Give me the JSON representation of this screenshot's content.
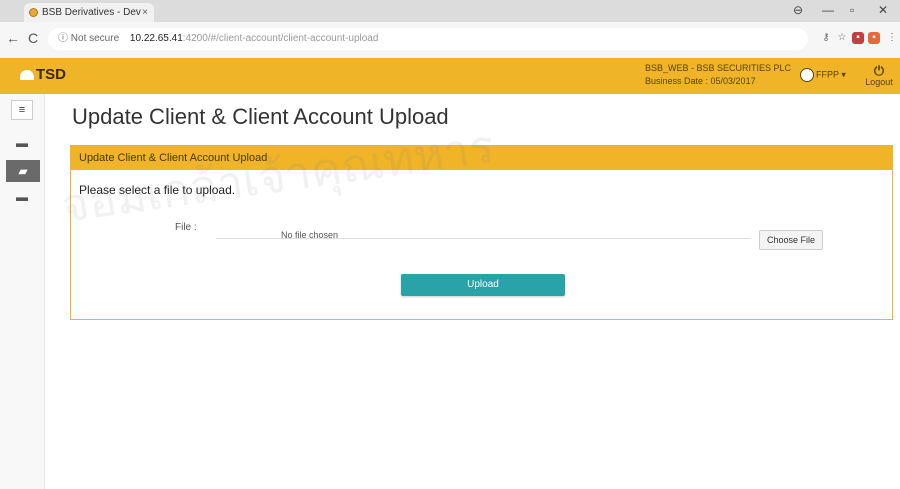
{
  "browser": {
    "tab_title": "BSB Derivatives - Dev",
    "security_label": "Not secure",
    "url_host": "10.22.65.41",
    "url_path": ":4200/#/client-account/client-account-upload"
  },
  "header": {
    "logo_text": "TSD",
    "company": "BSB_WEB - BSB SECURITIES PLC",
    "business_date": "Business Date : 05/03/2017",
    "user": "FFPP",
    "logout_label": "Logout",
    "accent_color": "#f0b429"
  },
  "page": {
    "title": "Update Client & Client Account Upload",
    "panel_title": "Update Client & Client Account Upload",
    "prompt": "Please select a file to upload.",
    "file_label": "File :",
    "file_status": "No file chosen",
    "choose_file_label": "Choose File",
    "upload_label": "Upload",
    "upload_color": "#2aa3a8"
  },
  "watermark": {
    "text": "จอมเกล้าเจ้าคุณทหาร"
  },
  "icons": [
    "back-arrow-icon",
    "reload-icon",
    "menu-icon",
    "folder-icon",
    "user-icon",
    "power-icon"
  ]
}
